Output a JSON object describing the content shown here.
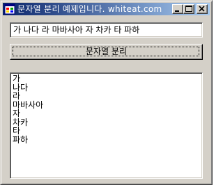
{
  "window": {
    "title": "문자열 분리 예제입니다. whiteat.com",
    "controls": [
      "minimize-icon",
      "maximize-icon",
      "close-icon"
    ]
  },
  "input": {
    "value": "가 나다 라 마바사아 자 차카 타 파하"
  },
  "split_button": {
    "label": "문자열 분리"
  },
  "result_list": {
    "items": [
      "가",
      "나다",
      "라",
      "마바사아",
      "자",
      "차카",
      "타",
      "파하"
    ]
  },
  "colors": {
    "face": "#d4d0c8",
    "title_active_start": "#0a246a",
    "title_active_end": "#a6caf0",
    "window_background": "#ffffff"
  }
}
